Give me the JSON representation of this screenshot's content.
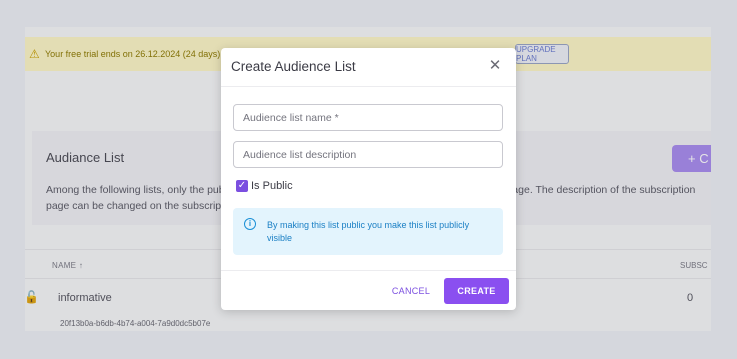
{
  "background": {
    "trial_text": "Your free trial ends on 26.12.2024 (24 days)",
    "upgrade_label": "UPGRADE PLAN",
    "card_title": "Audiance List",
    "card_desc": "Among the following lists, only the public lists will be shown to your subscribers on the subscription page. The description of the subscription page can be changed on the subscription page",
    "add_button_label": "+ C",
    "table": {
      "col_name": "NAME ↑",
      "col_subscribers": "SUBSC",
      "rows": [
        {
          "name": "informative",
          "count": "0",
          "id": "20f13b0a-b6db-4b74-a004-7a9d0dc5b07e"
        }
      ]
    }
  },
  "modal": {
    "title": "Create Audience List",
    "close_glyph": "✕",
    "name_placeholder": "Audience list name *",
    "desc_placeholder": "Audience list description",
    "is_public_label": "Is Public",
    "is_public_checked": true,
    "info_text": "By making this list public you make this list publicly visible",
    "cancel_label": "CANCEL",
    "create_label": "CREATE"
  },
  "colors": {
    "accent": "#8a4ff0",
    "info_bg": "#e3f4fd",
    "info_text": "#1a7fc4",
    "trial_bg": "#fdf6c7"
  }
}
